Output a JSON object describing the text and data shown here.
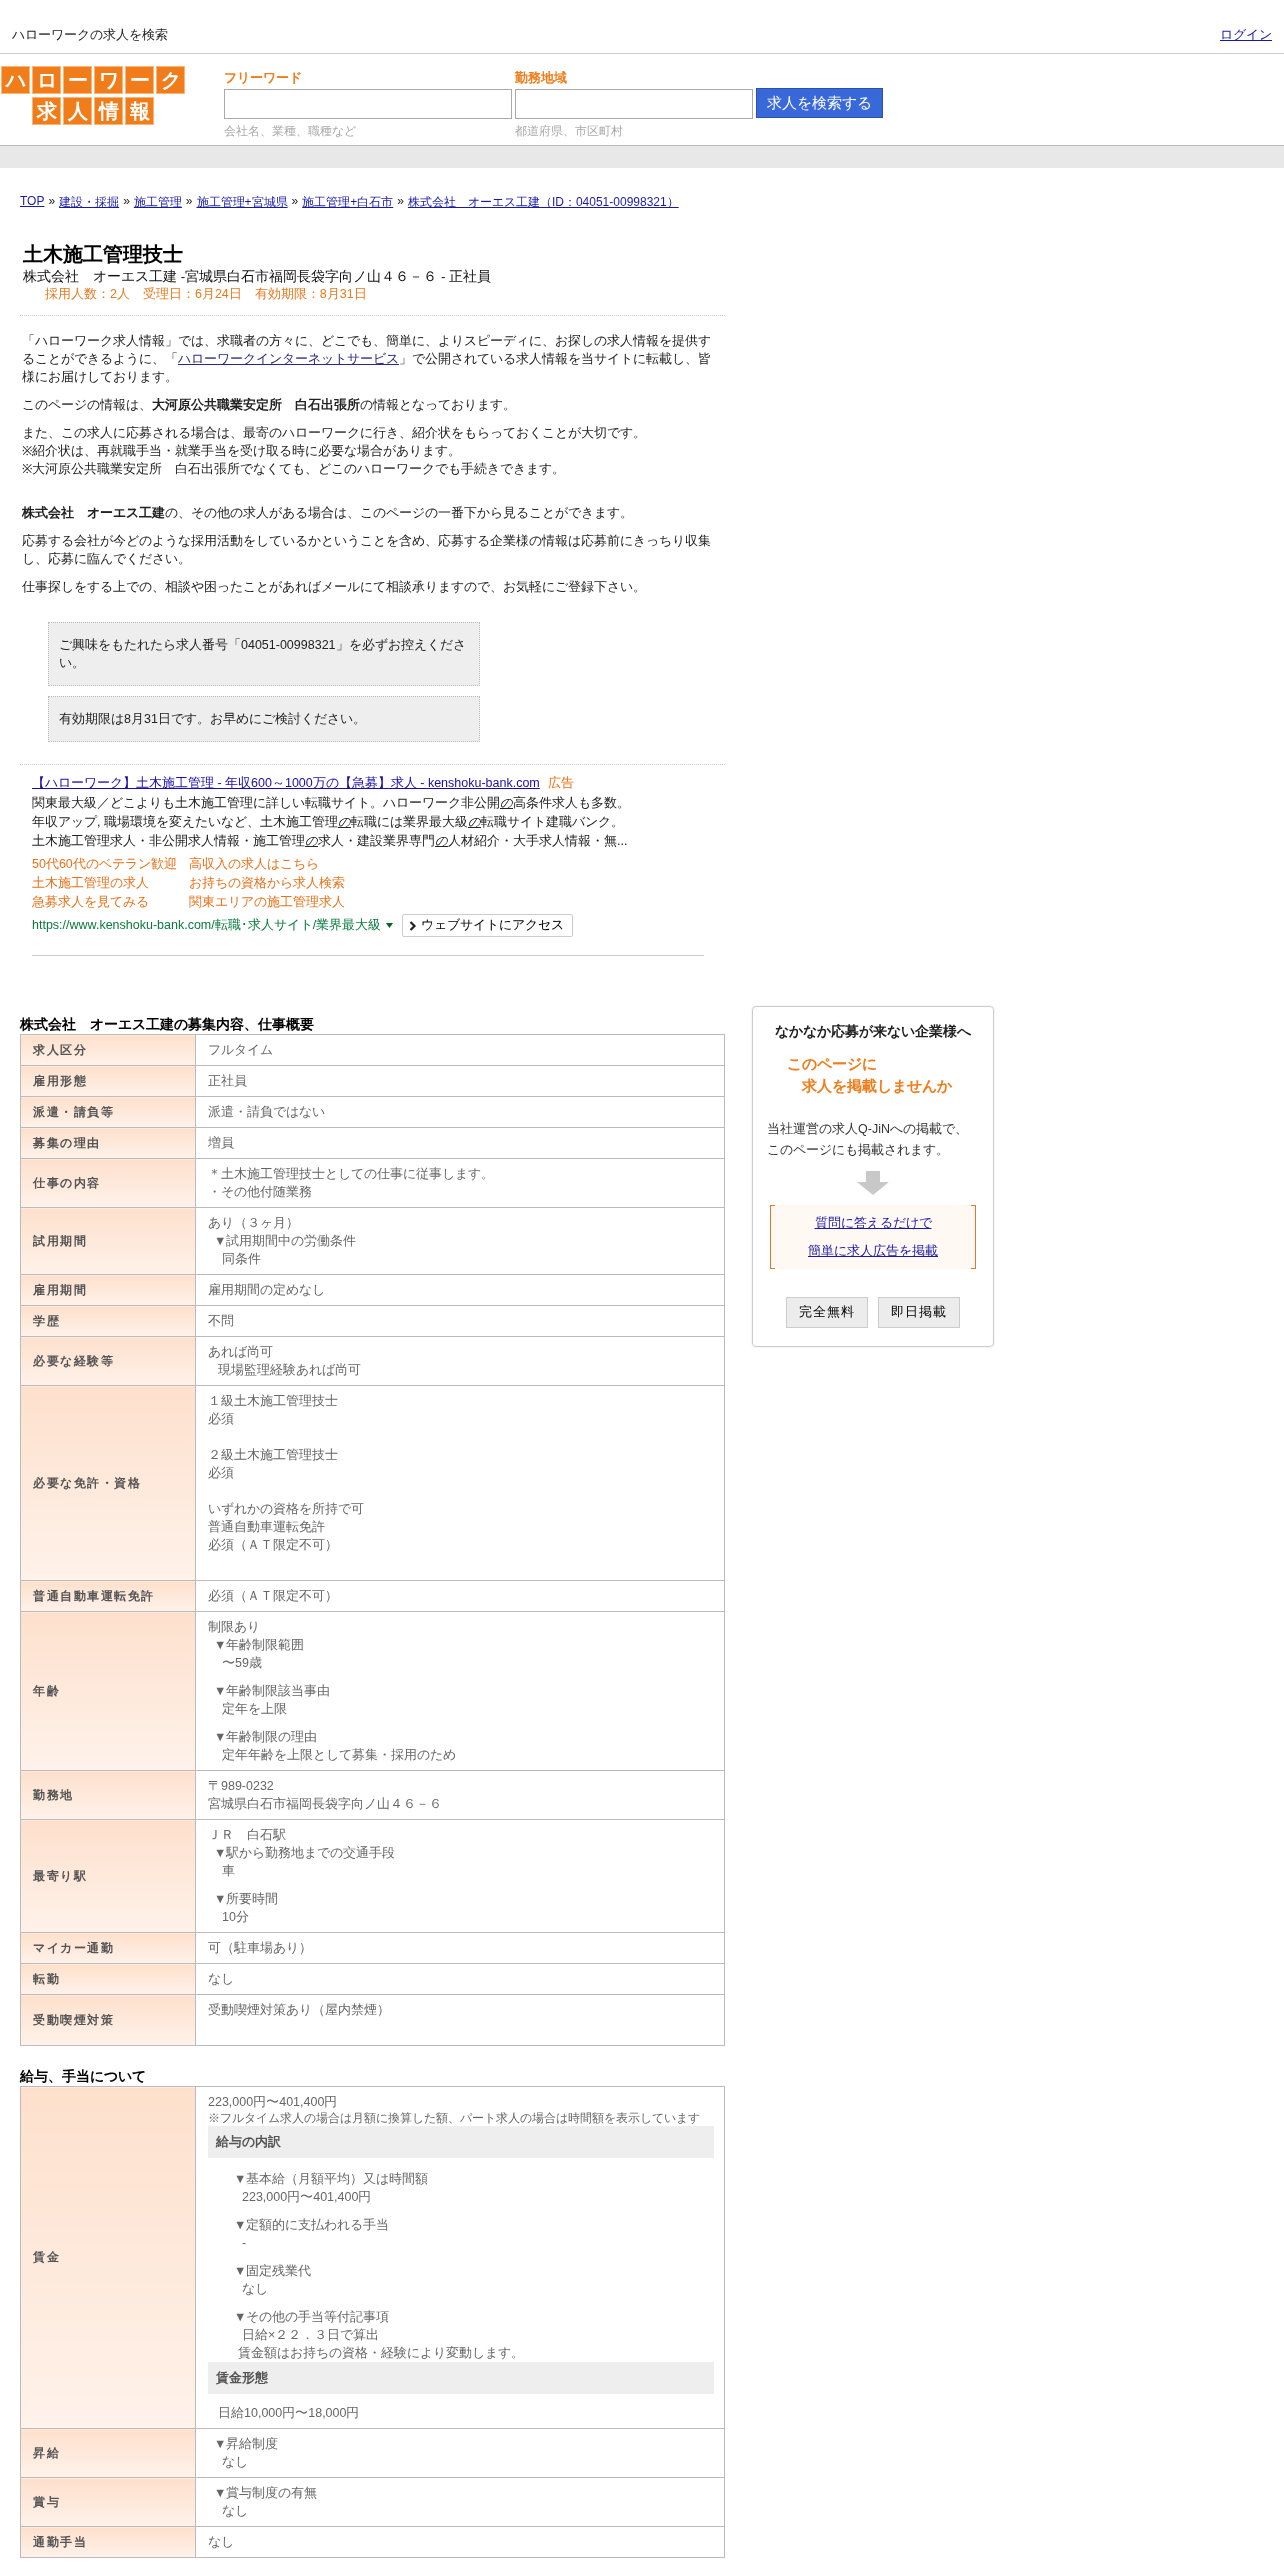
{
  "top_bar": {
    "title": "ハローワークの求人を検索",
    "login_link": "ログイン"
  },
  "header": {
    "logo": {
      "line_1": "ハローワーク",
      "line_2": "求人情報"
    },
    "search_fields": [
      {
        "label": "フリーワード",
        "hint": "会社名、業種、職種など"
      },
      {
        "label": "勤務地域",
        "hint": "都道府県、市区町村"
      }
    ],
    "search_button": "求人を検索する"
  },
  "breadcrumb": {
    "separator": "»",
    "items": [
      "TOP",
      "建設・採掘",
      "施工管理",
      "施工管理+宮城県",
      "施工管理+白石市",
      "株式会社　オーエス工建（ID：04051-00998321）"
    ]
  },
  "job": {
    "title": "土木施工管理技士",
    "subtitle": "株式会社　オーエス工建 -宮城県白石市福岡長袋字向ノ山４６－６ - 正社員",
    "meta": "採用人数：2人　受理日：6月24日　有効期限：8月31日"
  },
  "intro": [
    {
      "kind": "link_paragraph",
      "before": "「ハローワーク求人情報」では、求職者の方々に、どこでも、簡単に、よりスピーディに、お探しの求人情報を提供することができるように、「",
      "link": "ハローワークインターネットサービス",
      "after": "」で公開されている求人情報を当サイトに転載し、皆様にお届けしております。"
    },
    {
      "kind": "paragraph",
      "lines": [
        "このページの情報は、**大河原公共職業安定所　白石出張所**の情報となっております。"
      ]
    },
    {
      "kind": "paragraph",
      "lines": [
        "また、この求人に応募される場合は、最寄のハローワークに行き、紹介状をもらっておくことが大切です。",
        "※紹介状は、再就職手当・就業手当を受け取る時に必要な場合があります。",
        "※大河原公共職業安定所　白石出張所でなくても、どこのハローワークでも手続きできます。"
      ]
    },
    {
      "kind": "spaced_paragraph",
      "lines": [
        "**株式会社　オーエス工建**の、その他の求人がある場合は、このページの一番下から見ることができます。"
      ]
    },
    {
      "kind": "paragraph",
      "lines": [
        "応募する会社が今どのような採用活動をしているかということを含め、応募する企業様の情報は応募前にきっちり収集し、応募に臨んでください。"
      ]
    },
    {
      "kind": "paragraph",
      "lines": [
        "仕事探しをする上での、相談や困ったことがあればメールにて相談承りますので、お気軽にご登録下さい。"
      ]
    }
  ],
  "notices": [
    "ご興味をもたれたら求人番号「04051-00998321」を必ずお控えください。",
    "有効期限は8月31日です。お早めにご検討ください。"
  ],
  "ad": {
    "title": "【ハローワーク】土木施工管理 - 年収600～1000万の【急募】求人 - kenshoku-bank.com",
    "badge": "広告",
    "description": [
      [
        {
          "text": "関東最大級／どこよりも土木施工管理に詳しい転職サイト。ハローワーク非公開",
          "highlight": false
        },
        {
          "text": "の",
          "highlight": true
        },
        {
          "text": "高条件求人も多数。",
          "highlight": false
        }
      ],
      [
        {
          "text": "年収アップ, 職場環境を変えたいなど、土木施工管理",
          "highlight": false
        },
        {
          "text": "の",
          "highlight": true
        },
        {
          "text": "転職には業界最大級",
          "highlight": false
        },
        {
          "text": "の",
          "highlight": true
        },
        {
          "text": "転職サイト建職バンク。",
          "highlight": false
        }
      ],
      [
        {
          "text": "土木施工管理求人・非公開求人情報・施工管理",
          "highlight": false
        },
        {
          "text": "の",
          "highlight": true
        },
        {
          "text": "求人・建設業界専門",
          "highlight": false
        },
        {
          "text": "の",
          "highlight": true
        },
        {
          "text": "人材紹介・大手求人情報・無...",
          "highlight": false
        }
      ]
    ],
    "sitelinks": [
      "50代60代のベテラン歓迎",
      "高収入の求人はこちら",
      "土木施工管理の求人",
      "お持ちの資格から求人検索",
      "急募求人を見てみる",
      "関東エリアの施工管理求人"
    ],
    "url": "https://www.kenshoku-bank.com/転職･求人サイト/業界最大級",
    "visit_button": "ウェブサイトにアクセス"
  },
  "job_table": {
    "title": "株式会社　オーエス工建の募集内容、仕事概要",
    "rows": [
      {
        "label": "求人区分",
        "blocks": [
          {
            "kind": "text",
            "lines": [
              "フルタイム"
            ]
          }
        ]
      },
      {
        "label": "雇用形態",
        "blocks": [
          {
            "kind": "text",
            "lines": [
              "正社員"
            ]
          }
        ]
      },
      {
        "label": "派遣・請負等",
        "blocks": [
          {
            "kind": "text",
            "lines": [
              "派遣・請負ではない"
            ]
          }
        ]
      },
      {
        "label": "募集の理由",
        "blocks": [
          {
            "kind": "text",
            "lines": [
              "増員"
            ]
          }
        ]
      },
      {
        "label": "仕事の内容",
        "blocks": [
          {
            "kind": "text",
            "lines": [
              "＊土木施工管理技士としての仕事に従事します。",
              "・その他付随業務"
            ]
          }
        ]
      },
      {
        "label": "試用期間",
        "blocks": [
          {
            "kind": "text",
            "lines": [
              "あり（３ヶ月）"
            ]
          },
          {
            "kind": "item",
            "heading": "▼試用期間中の労働条件",
            "lines": [
              "同条件"
            ]
          }
        ]
      },
      {
        "label": "雇用期間",
        "blocks": [
          {
            "kind": "text",
            "lines": [
              "雇用期間の定めなし"
            ]
          }
        ]
      },
      {
        "label": "学歴",
        "blocks": [
          {
            "kind": "text",
            "lines": [
              "不問"
            ]
          }
        ]
      },
      {
        "label": "必要な経験等",
        "blocks": [
          {
            "kind": "text",
            "lines": [
              "あれば尚可"
            ]
          },
          {
            "kind": "note",
            "lines": [
              "現場監理経験あれば尚可"
            ]
          }
        ]
      },
      {
        "label": "必要な免許・資格",
        "blocks": [
          {
            "kind": "text",
            "lines": [
              "１級土木施工管理技士",
              "必須"
            ]
          },
          {
            "kind": "text",
            "lines": [
              "２級土木施工管理技士",
              "必須"
            ]
          },
          {
            "kind": "text",
            "lines": [
              "いずれかの資格を所持で可",
              "普通自動車運転免許",
              "必須（ＡＴ限定不可）"
            ]
          },
          {
            "kind": "spacer"
          }
        ]
      },
      {
        "label": "普通自動車運転免許",
        "blocks": [
          {
            "kind": "text",
            "lines": [
              "必須（ＡＴ限定不可）"
            ]
          }
        ]
      },
      {
        "label": "年齢",
        "blocks": [
          {
            "kind": "text",
            "lines": [
              "制限あり"
            ]
          },
          {
            "kind": "item",
            "heading": "▼年齢制限範囲",
            "lines": [
              "〜59歳"
            ]
          },
          {
            "kind": "item",
            "heading": "▼年齢制限該当事由",
            "lines": [
              "定年を上限"
            ]
          },
          {
            "kind": "item",
            "heading": "▼年齢制限の理由",
            "lines": [
              "定年年齢を上限として募集・採用のため"
            ]
          }
        ]
      },
      {
        "label": "勤務地",
        "blocks": [
          {
            "kind": "text",
            "lines": [
              "〒989-0232",
              "宮城県白石市福岡長袋字向ノ山４６－６"
            ]
          }
        ]
      },
      {
        "label": "最寄り駅",
        "blocks": [
          {
            "kind": "text",
            "lines": [
              "ＪＲ　白石駅"
            ]
          },
          {
            "kind": "item",
            "heading": "▼駅から勤務地までの交通手段",
            "lines": [
              "車"
            ]
          },
          {
            "kind": "item",
            "heading": "▼所要時間",
            "lines": [
              "10分"
            ]
          }
        ]
      },
      {
        "label": "マイカー通勤",
        "blocks": [
          {
            "kind": "text",
            "lines": [
              "可（駐車場あり）"
            ]
          }
        ]
      },
      {
        "label": "転勤",
        "blocks": [
          {
            "kind": "text",
            "lines": [
              "なし"
            ]
          }
        ]
      },
      {
        "label": "受動喫煙対策",
        "blocks": [
          {
            "kind": "text",
            "lines": [
              "受動喫煙対策あり（屋内禁煙）"
            ]
          },
          {
            "kind": "spacer"
          }
        ]
      }
    ]
  },
  "pay_table": {
    "title": "給与、手当について",
    "rows": [
      {
        "label": "賃金",
        "blocks": [
          {
            "kind": "text",
            "lines": [
              "223,000円〜401,400円"
            ]
          },
          {
            "kind": "small_note",
            "lines": [
              "※フルタイム求人の場合は月額に換算した額、パート求人の場合は時間額を表示しています"
            ]
          },
          {
            "kind": "section",
            "lines": [
              "給与の内訳"
            ]
          },
          {
            "kind": "sub_item",
            "heading": "▼基本給（月額平均）又は時間額",
            "lines": [
              "223,000円〜401,400円"
            ]
          },
          {
            "kind": "sub_item",
            "heading": "▼定額的に支払われる手当",
            "lines": [
              "-"
            ]
          },
          {
            "kind": "sub_item",
            "heading": "▼固定残業代",
            "lines": [
              "なし"
            ]
          },
          {
            "kind": "sub_item",
            "heading": "▼その他の手当等付記事項",
            "lines": [
              "日給×２２．３日で算出"
            ]
          },
          {
            "kind": "sub_note",
            "lines": [
              "賃金額はお持ちの資格・経験により変動します。"
            ]
          },
          {
            "kind": "section",
            "lines": [
              "賃金形態"
            ]
          },
          {
            "kind": "note",
            "lines": [
              "日給10,000円〜18,000円"
            ]
          }
        ]
      },
      {
        "label": "昇給",
        "blocks": [
          {
            "kind": "item",
            "heading": "▼昇給制度",
            "lines": [
              "なし"
            ]
          }
        ]
      },
      {
        "label": "賞与",
        "blocks": [
          {
            "kind": "item",
            "heading": "▼賞与制度の有無",
            "lines": [
              "なし"
            ]
          }
        ]
      },
      {
        "label": "通勤手当",
        "blocks": [
          {
            "kind": "text",
            "lines": [
              "なし"
            ]
          }
        ]
      }
    ]
  },
  "promo": {
    "heading": "なかなか応募が来ない企業様へ",
    "catch": [
      "このページに",
      "求人を掲載しませんか"
    ],
    "text": "当社運営の求人Q-JiNへの掲載で、このページにも掲載されます。",
    "links": [
      "質問に答えるだけで",
      "簡単に求人広告を掲載"
    ],
    "buttons": [
      "完全無料",
      "即日掲載"
    ]
  }
}
